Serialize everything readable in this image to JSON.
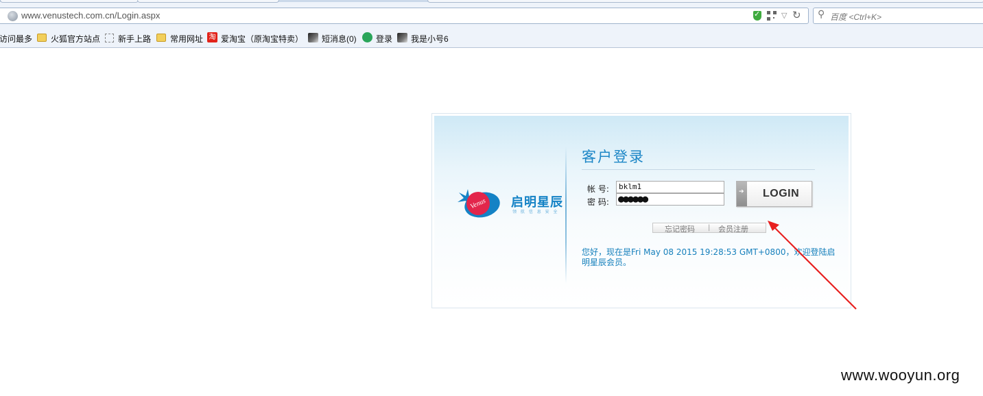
{
  "browser": {
    "url": "www.venustech.com.cn/Login.aspx",
    "search_placeholder": "百度 <Ctrl+K>",
    "bookmarks": [
      {
        "label": "访问最多",
        "icon": "folder-icon"
      },
      {
        "label": "火狐官方站点",
        "icon": "folder-icon"
      },
      {
        "label": "新手上路",
        "icon": "dashed-box-icon"
      },
      {
        "label": "常用网址",
        "icon": "folder-icon"
      },
      {
        "label": "爱淘宝（原淘宝特卖）",
        "icon": "taobao-icon"
      },
      {
        "label": "短消息(0)",
        "icon": "image-icon"
      },
      {
        "label": "登录",
        "icon": "green-globe-icon"
      },
      {
        "label": "我是小号6",
        "icon": "image-icon"
      }
    ],
    "taobao_icon_char": "淘"
  },
  "brand": {
    "name": "启明星辰",
    "tagline": "领 航 信 息 安 全",
    "mark_text": "Venus",
    "colors": {
      "blue": "#1482c5",
      "red": "#e3264b"
    }
  },
  "login": {
    "title": "客户登录",
    "account_label": "帐 号:",
    "account_value": "bklm1",
    "password_label": "密 码:",
    "password_masked": "●●●●●●",
    "button_label": "LOGIN",
    "forgot_label": "忘记密码",
    "separator": "|",
    "register_label": "会员注册",
    "greeting": "您好，现在是Fri May 08 2015 19:28:53 GMT+0800，欢迎登陆启明星辰会员。"
  },
  "annotation": {
    "arrow_color": "#e8201f"
  },
  "watermark": "www.wooyun.org"
}
